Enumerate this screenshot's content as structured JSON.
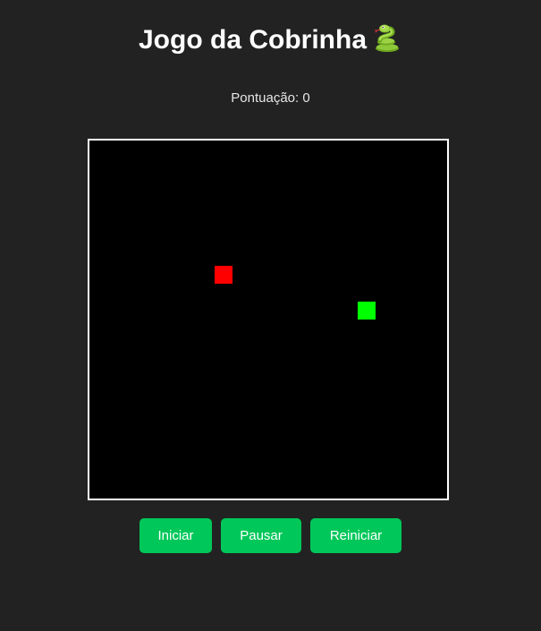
{
  "header": {
    "title": "Jogo da Cobrinha",
    "icon": "snake-icon"
  },
  "score": {
    "label": "Pontuação: 0",
    "value": 0
  },
  "board": {
    "grid_cols": 20,
    "grid_rows": 20,
    "background": "#000000",
    "border_color": "#ffffff",
    "food": {
      "col": 7,
      "row": 7,
      "color": "#ff0000"
    },
    "snake": [
      {
        "col": 15,
        "row": 9
      }
    ],
    "snake_color": "#00ff00"
  },
  "controls": {
    "start_label": "Iniciar",
    "pause_label": "Pausar",
    "restart_label": "Reiniciar",
    "button_color": "#00c759"
  },
  "colors": {
    "page_background": "#222222",
    "text": "#ffffff"
  }
}
